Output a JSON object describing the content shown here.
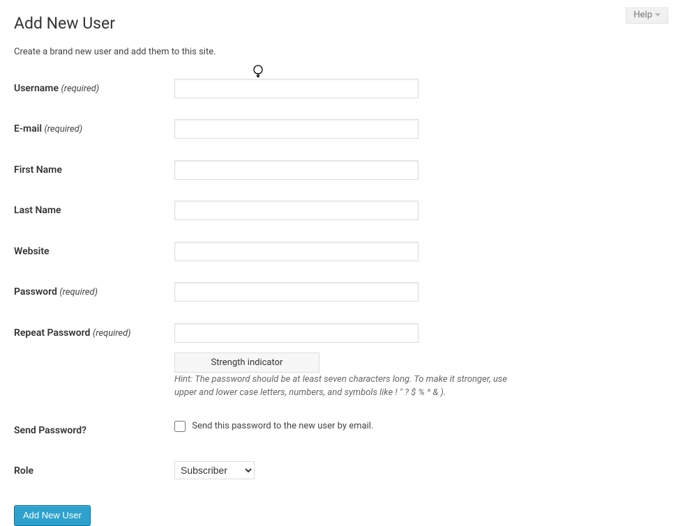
{
  "help": {
    "label": "Help"
  },
  "page": {
    "title": "Add New User",
    "subheading": "Create a brand new user and add them to this site."
  },
  "fields": {
    "username": {
      "label": "Username",
      "required": "(required)",
      "value": ""
    },
    "email": {
      "label": "E-mail",
      "required": "(required)",
      "value": ""
    },
    "first_name": {
      "label": "First Name",
      "value": ""
    },
    "last_name": {
      "label": "Last Name",
      "value": ""
    },
    "website": {
      "label": "Website",
      "value": ""
    },
    "password": {
      "label": "Password",
      "required": "(required)",
      "value": ""
    },
    "repeat_password": {
      "label": "Repeat Password",
      "required": "(required)",
      "value": ""
    },
    "strength_indicator": "Strength indicator",
    "password_hint": "Hint: The password should be at least seven characters long. To make it stronger, use upper and lower case letters, numbers, and symbols like ! \" ? $ % ^ & ).",
    "send_password": {
      "label": "Send Password?",
      "checkbox_label": "Send this password to the new user by email."
    },
    "role": {
      "label": "Role",
      "selected": "Subscriber"
    }
  },
  "submit": {
    "label": "Add New User"
  }
}
